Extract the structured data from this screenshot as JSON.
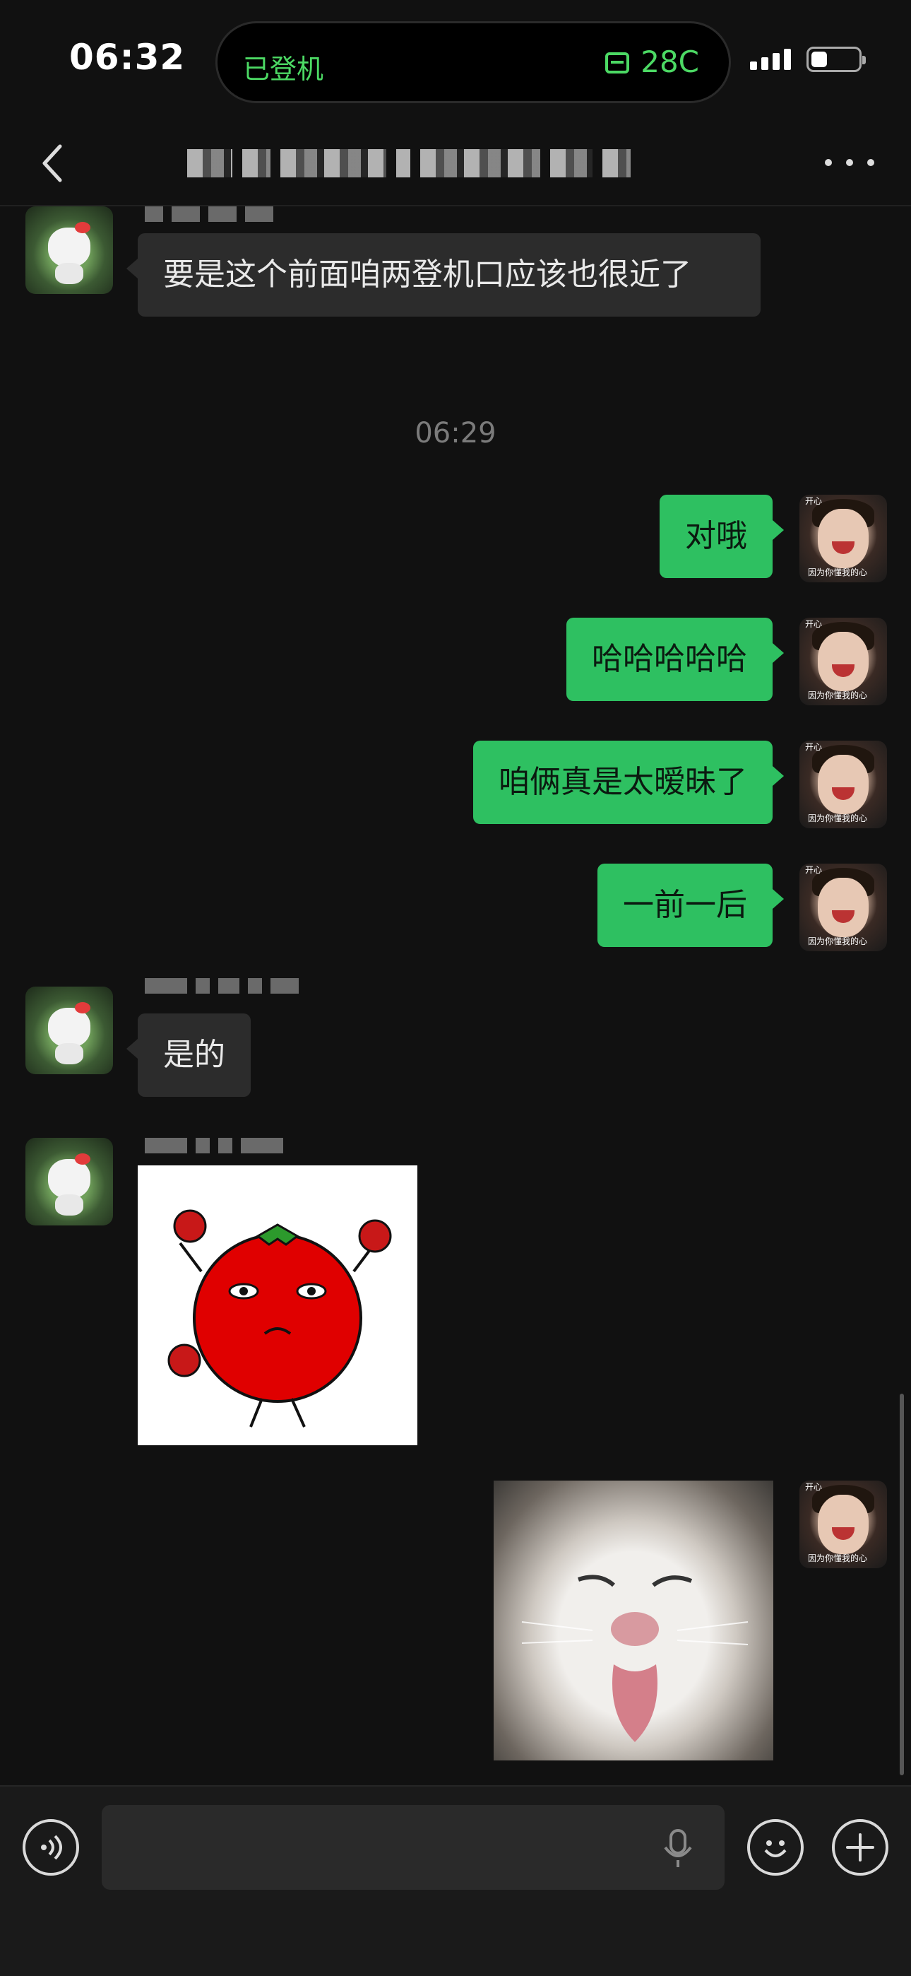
{
  "status_bar": {
    "time": "06:32",
    "island_left": "已登机",
    "island_right": "28C",
    "battery_level": 0.35
  },
  "header": {
    "back_icon": "chevron-left-icon",
    "more_icon": "more-dots-icon"
  },
  "messages": [
    {
      "side": "in",
      "text": "要是这个前面咱两登机口应该也很近了"
    },
    {
      "timestamp": "06:29"
    },
    {
      "side": "out",
      "text": "对哦"
    },
    {
      "side": "out",
      "text": "哈哈哈哈哈"
    },
    {
      "side": "out",
      "text": "咱俩真是太暧昧了"
    },
    {
      "side": "out",
      "text": "一前一后"
    },
    {
      "side": "in",
      "text": "是的"
    },
    {
      "side": "in",
      "type": "sticker",
      "sticker": "tomato-with-roses"
    },
    {
      "side": "out",
      "type": "sticker",
      "sticker": "cat-tongue"
    }
  ],
  "avatar_right": {
    "caption_top": "开心",
    "caption_bottom": "因为你懂我的心"
  },
  "input": {
    "placeholder": "",
    "icons": [
      "voice-icon",
      "mic-icon",
      "emoji-icon",
      "plus-icon"
    ]
  },
  "colors": {
    "background": "#111111",
    "outgoing_bubble": "#2ec061",
    "incoming_bubble": "#2c2c2c",
    "island_text": "#4cd964"
  }
}
